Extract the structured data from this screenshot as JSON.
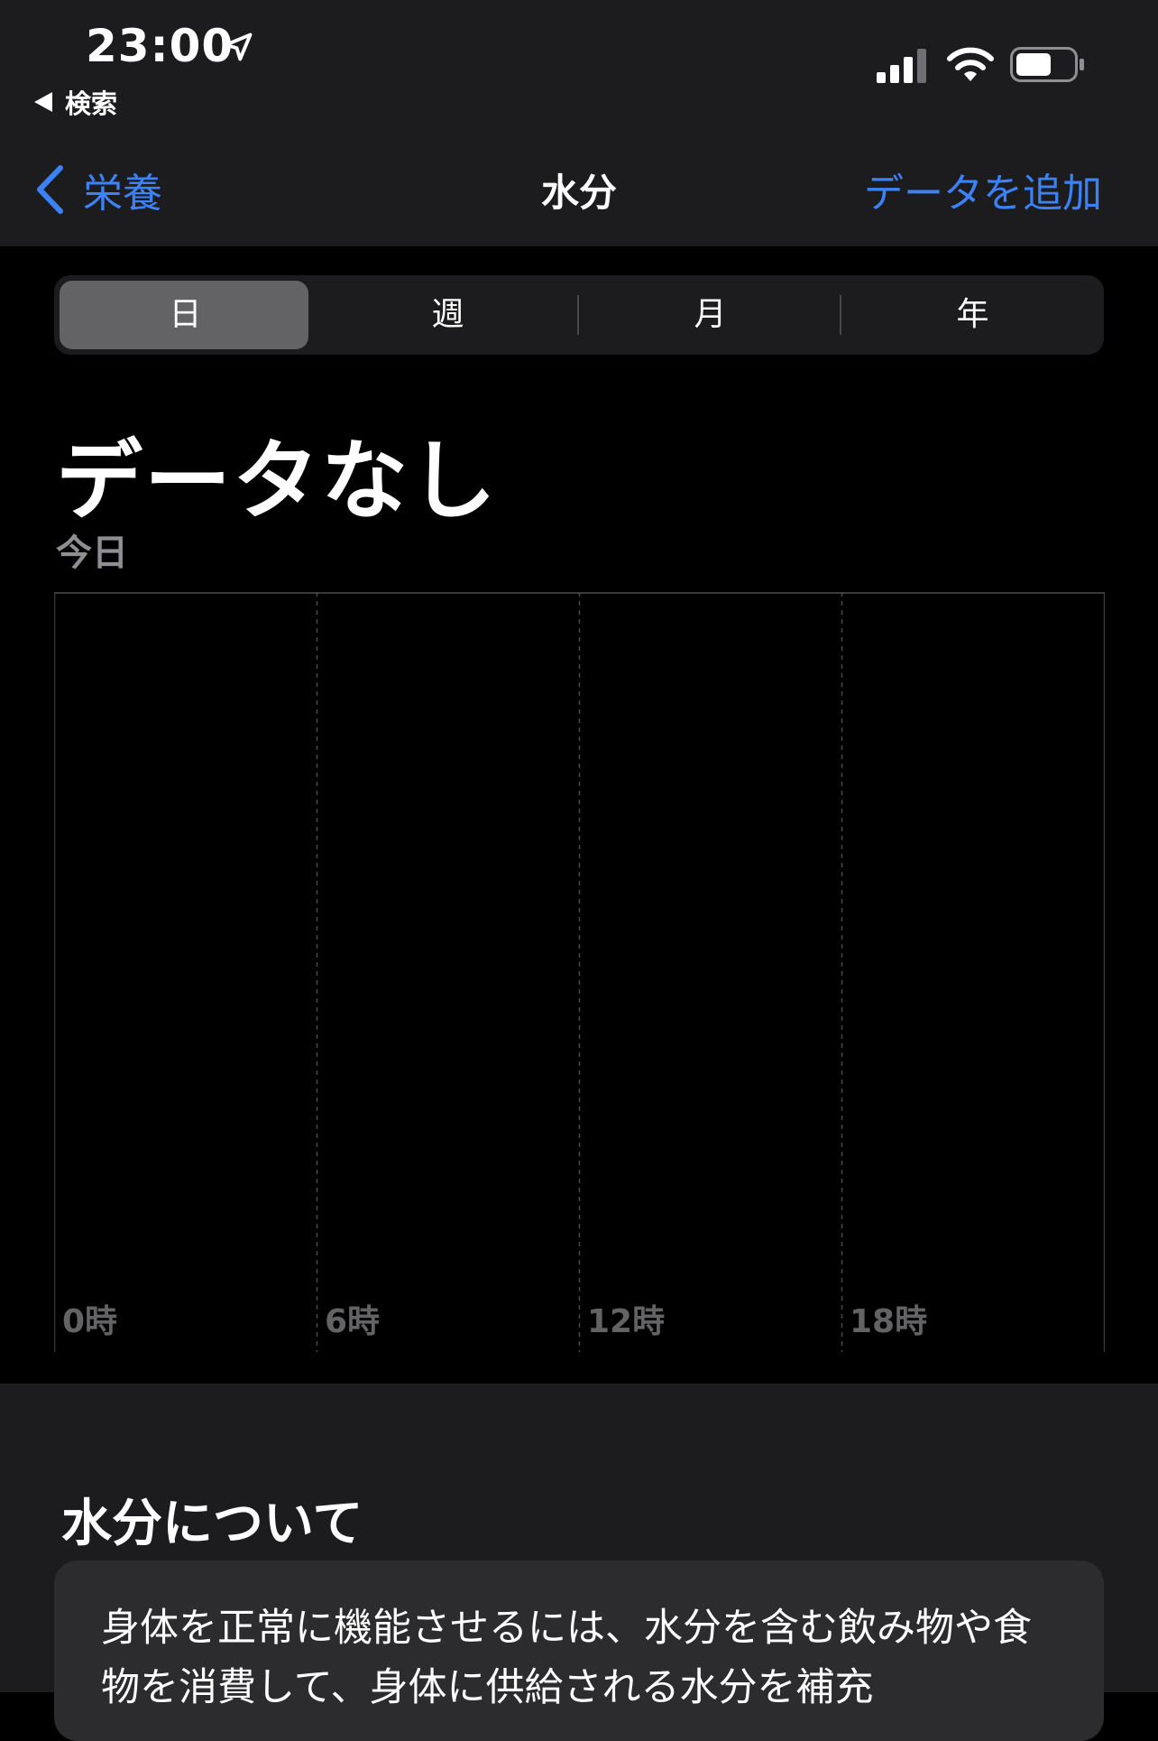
{
  "status_bar": {
    "time": "23:00",
    "back_app_label": "検索"
  },
  "nav": {
    "back_label": "栄養",
    "title": "水分",
    "add_label": "データを追加"
  },
  "segments": {
    "items": [
      "日",
      "週",
      "月",
      "年"
    ],
    "selected": "日"
  },
  "summary": {
    "headline": "データなし",
    "period": "今日"
  },
  "chart_data": {
    "type": "bar",
    "x_tick_labels": [
      "0時",
      "6時",
      "12時",
      "18時"
    ],
    "series": [],
    "grid": "vertical dashed"
  },
  "about": {
    "title": "水分について",
    "body": "身体を正常に機能させるには、水分を含む飲み物や食物を消費して、身体に供給される水分を補充"
  },
  "colors": {
    "accent": "#3b82f6",
    "background": "#000000",
    "surface": "#1c1c1e",
    "secondary_text": "#8e8e93"
  }
}
